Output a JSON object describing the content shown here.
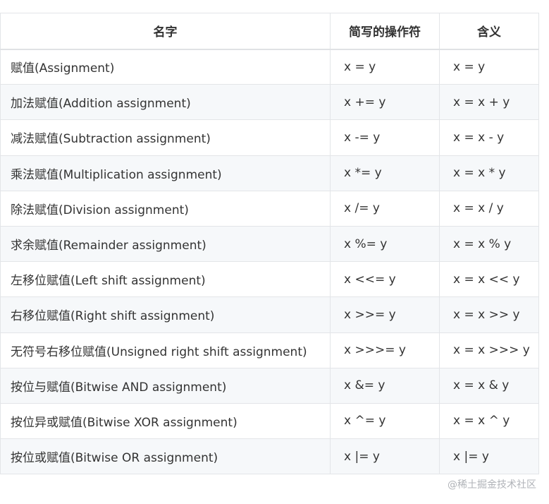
{
  "table": {
    "headers": [
      "名字",
      "简写的操作符",
      "含义"
    ],
    "rows": [
      {
        "name": "赋值(Assignment)",
        "op": "x = y",
        "meaning": "x = y"
      },
      {
        "name": "加法赋值(Addition assignment)",
        "op": "x += y",
        "meaning": "x = x + y"
      },
      {
        "name": "减法赋值(Subtraction assignment)",
        "op": "x -= y",
        "meaning": "x = x - y"
      },
      {
        "name": "乘法赋值(Multiplication assignment)",
        "op": "x *= y",
        "meaning": "x = x * y"
      },
      {
        "name": "除法赋值(Division assignment)",
        "op": "x /= y",
        "meaning": "x = x / y"
      },
      {
        "name": "求余赋值(Remainder assignment)",
        "op": "x %= y",
        "meaning": "x = x % y"
      },
      {
        "name": "左移位赋值(Left shift assignment)",
        "op": "x <<= y",
        "meaning": "x = x << y"
      },
      {
        "name": "右移位赋值(Right shift assignment)",
        "op": "x >>= y",
        "meaning": "x = x >> y"
      },
      {
        "name": "无符号右移位赋值(Unsigned right shift assignment)",
        "op": "x >>>= y",
        "meaning": "x = x >>> y"
      },
      {
        "name": "按位与赋值(Bitwise AND assignment)",
        "op": "x &= y",
        "meaning": "x = x & y"
      },
      {
        "name": "按位异或赋值(Bitwise XOR assignment)",
        "op": "x ^= y",
        "meaning": "x = x ^ y"
      },
      {
        "name": "按位或赋值(Bitwise OR assignment)",
        "op": "x |= y",
        "meaning": "x |= y"
      }
    ]
  },
  "watermark": "@稀土掘金技术社区"
}
